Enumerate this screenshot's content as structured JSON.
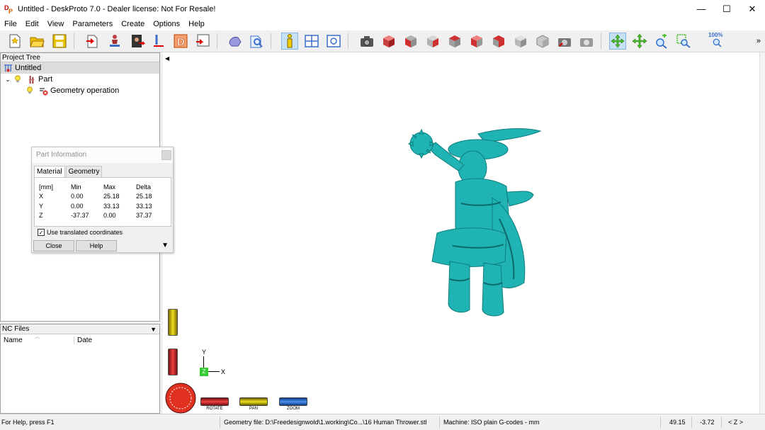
{
  "window": {
    "title": "Untitled - DeskProto 7.0 - Dealer license: Not For Resale!",
    "logo_text_1": "D",
    "logo_text_2": "P",
    "minimize": "—",
    "maximize": "☐",
    "close": "✕"
  },
  "menu": [
    "File",
    "Edit",
    "View",
    "Parameters",
    "Create",
    "Options",
    "Help"
  ],
  "toolbar": {
    "zoom_label": "100%",
    "more": "»"
  },
  "project_tree": {
    "header": "Project Tree",
    "root": "Untitled",
    "part": "Part",
    "operation": "Geometry operation"
  },
  "nc_files": {
    "header": "NC Files",
    "columns": [
      "Name",
      "Date"
    ]
  },
  "part_info": {
    "title": "Part Information",
    "tabs": [
      "Material",
      "Geometry"
    ],
    "columns": [
      "[mm]",
      "Min",
      "Max",
      "Delta"
    ],
    "rows": [
      [
        "X",
        "0.00",
        "25.18",
        "25.18"
      ],
      [
        "Y",
        "0.00",
        "33.13",
        "33.13"
      ],
      [
        "Z",
        "-37.37",
        "0.00",
        "37.37"
      ]
    ],
    "use_translated": "Use translated coordinates",
    "close_button": "Close",
    "help_button": "Help"
  },
  "viewport": {
    "axis_y": "Y",
    "axis_x": "X",
    "axis_z": "Z",
    "dial_labels": [
      "ROTATE",
      "PAN",
      "ZOOM"
    ],
    "model_color": "#1fb3b3"
  },
  "status": {
    "help": "For Help, press F1",
    "geometry_file": "Geometry file: D:\\Freedesignwold\\1.working\\Co...\\16 Human Thrower.stl",
    "machine": "Machine: ISO plain G-codes - mm",
    "coord_x": "49.15",
    "coord_y": "-3.72",
    "axis_mode": "< Z >"
  }
}
